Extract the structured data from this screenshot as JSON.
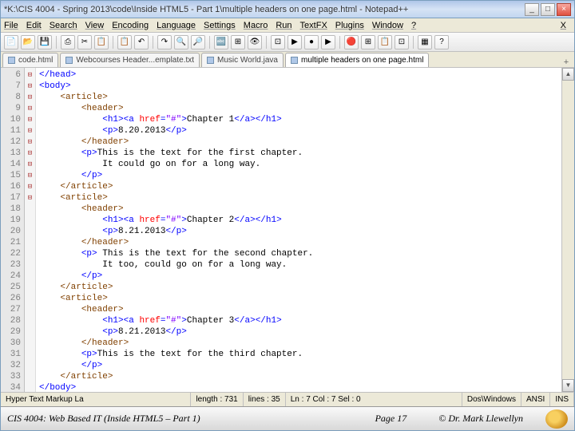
{
  "titlebar": {
    "text": "*K:\\CIS 4004 - Spring 2013\\code\\Inside HTML5 - Part 1\\multiple headers on one page.html - Notepad++"
  },
  "winbtns": {
    "min": "_",
    "max": "□",
    "close": "×"
  },
  "menu": [
    "File",
    "Edit",
    "Search",
    "View",
    "Encoding",
    "Language",
    "Settings",
    "Macro",
    "Run",
    "TextFX",
    "Plugins",
    "Window",
    "?"
  ],
  "menu_x": "X",
  "tabs": [
    {
      "label": "code.html",
      "active": false
    },
    {
      "label": "Webcourses Header...emplate.txt",
      "active": false
    },
    {
      "label": "Music World.java",
      "active": false
    },
    {
      "label": "multiple headers on one page.html",
      "active": true
    }
  ],
  "gutter_start": 6,
  "fold": [
    "",
    "⊟",
    "⊟",
    "⊟",
    "",
    "",
    "⊟",
    "⊟",
    "",
    "",
    "",
    "⊟",
    "⊟",
    "",
    "",
    "⊟",
    "⊟",
    "",
    "",
    "",
    "⊟",
    "⊟",
    "",
    "",
    "⊟",
    "",
    "",
    "",
    ""
  ],
  "code": [
    [
      [
        "</head>",
        "blue"
      ]
    ],
    [
      [
        "<body>",
        "blue"
      ]
    ],
    [
      [
        "<article>",
        "brown",
        "i1"
      ]
    ],
    [
      [
        "<header>",
        "brown",
        "i2"
      ]
    ],
    [
      [
        "<h1><a ",
        "blue",
        "i3"
      ],
      [
        "href",
        "attr"
      ],
      [
        "=",
        "blue"
      ],
      [
        "\"#\"",
        "val"
      ],
      [
        ">",
        "blue"
      ],
      [
        "Chapter 1",
        ""
      ],
      [
        "</a></h1>",
        "blue"
      ]
    ],
    [
      [
        "<p>",
        "blue",
        "i3"
      ],
      [
        "8.20.2013",
        ""
      ],
      [
        "</p>",
        "blue"
      ]
    ],
    [
      [
        "</header>",
        "brown",
        "i2"
      ]
    ],
    [
      [
        "<p>",
        "blue",
        "i2"
      ],
      [
        "This is the text for the first chapter.",
        ""
      ]
    ],
    [
      [
        "It could go on for a long way.",
        "",
        "i3"
      ]
    ],
    [
      [
        "</p>",
        "blue",
        "i2"
      ]
    ],
    [
      [
        "</article>",
        "brown",
        "i1"
      ]
    ],
    [
      [
        "<article>",
        "brown",
        "i1"
      ]
    ],
    [
      [
        "<header>",
        "brown",
        "i2"
      ]
    ],
    [
      [
        "<h1><a ",
        "blue",
        "i3"
      ],
      [
        "href",
        "attr"
      ],
      [
        "=",
        "blue"
      ],
      [
        "\"#\"",
        "val"
      ],
      [
        ">",
        "blue"
      ],
      [
        "Chapter 2",
        ""
      ],
      [
        "</a></h1>",
        "blue"
      ]
    ],
    [
      [
        "<p>",
        "blue",
        "i3"
      ],
      [
        "8.21.2013",
        ""
      ],
      [
        "</p>",
        "blue"
      ]
    ],
    [
      [
        "</header>",
        "brown",
        "i2"
      ]
    ],
    [
      [
        "<p>",
        "blue",
        "i2"
      ],
      [
        " This is the text for the second chapter.",
        ""
      ]
    ],
    [
      [
        "It too, could go on for a long way.",
        "",
        "i3"
      ]
    ],
    [
      [
        "</p>",
        "blue",
        "i2"
      ]
    ],
    [
      [
        "</article>",
        "brown",
        "i1"
      ]
    ],
    [
      [
        "<article>",
        "brown",
        "i1"
      ]
    ],
    [
      [
        "<header>",
        "brown",
        "i2"
      ]
    ],
    [
      [
        "<h1><a ",
        "blue",
        "i3"
      ],
      [
        "href",
        "attr"
      ],
      [
        "=",
        "blue"
      ],
      [
        "\"#\"",
        "val"
      ],
      [
        ">",
        "blue"
      ],
      [
        "Chapter 3",
        ""
      ],
      [
        "</a></h1>",
        "blue"
      ]
    ],
    [
      [
        "<p>",
        "blue",
        "i3"
      ],
      [
        "8.21.2013",
        ""
      ],
      [
        "</p>",
        "blue"
      ]
    ],
    [
      [
        "</header>",
        "brown",
        "i2"
      ]
    ],
    [
      [
        "<p>",
        "blue",
        "i2"
      ],
      [
        "This is the text for the third chapter.",
        ""
      ]
    ],
    [
      [
        "</p>",
        "blue",
        "i2"
      ]
    ],
    [
      [
        "</article>",
        "brown",
        "i1"
      ]
    ],
    [
      [
        "</body>",
        "blue"
      ]
    ]
  ],
  "status": {
    "lang": "Hyper Text Markup La",
    "length": "length : 731",
    "lines": "lines : 35",
    "pos": "Ln : 7   Col : 7   Sel : 0",
    "eol": "Dos\\Windows",
    "enc": "ANSI",
    "mode": "INS"
  },
  "footer": {
    "course": "CIS 4004: Web Based IT (Inside HTML5 – Part 1)",
    "page": "Page 17",
    "copy": "© Dr. Mark Llewellyn"
  },
  "toolbar_icons": [
    "📄",
    "📂",
    "💾",
    "⎙",
    "✂",
    "📋",
    "📋",
    "↶",
    "↷",
    "🔍",
    "🔎",
    "🔤",
    "⊞",
    "👁",
    "⊡",
    "▶",
    "●",
    "▶",
    "🔴",
    "⊞",
    "📋",
    "⊡",
    "▦",
    "?"
  ]
}
